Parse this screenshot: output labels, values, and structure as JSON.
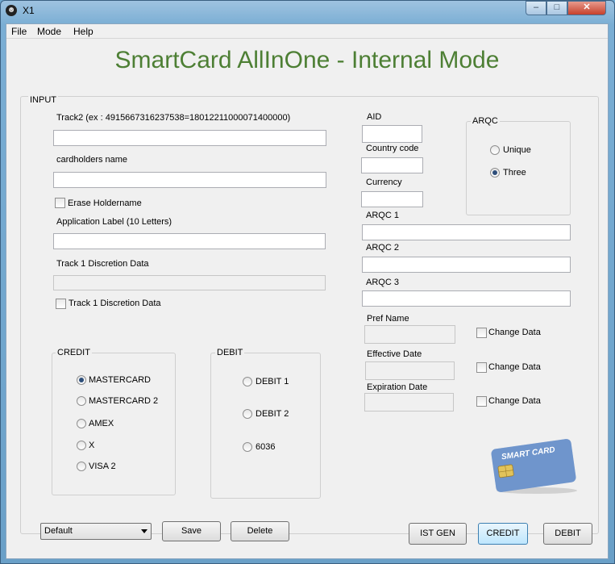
{
  "window": {
    "title": "X1",
    "controls": {
      "minimize": "–",
      "maximize": "□",
      "close": "✕"
    }
  },
  "menu": [
    "File",
    "Mode",
    "Help"
  ],
  "heading": "SmartCard AllInOne - Internal Mode",
  "input_group": {
    "label": "INPUT",
    "track2_label": "Track2 (ex : 4915667316237538=18012211000071400000)",
    "track2_value": "",
    "cardholder_label": "cardholders name",
    "cardholder_value": "",
    "erase_holdername": {
      "label": "Erase Holdername",
      "checked": false
    },
    "app_label_label": "Application Label (10 Letters)",
    "app_label_value": "",
    "track1_label": "Track 1 Discretion Data",
    "track1_value": "",
    "track1_checkbox": {
      "label": "Track 1 Discretion Data",
      "checked": false
    }
  },
  "credit": {
    "label": "CREDIT",
    "options": [
      {
        "label": "MASTERCARD",
        "checked": true
      },
      {
        "label": "MASTERCARD 2",
        "checked": false
      },
      {
        "label": "AMEX",
        "checked": false
      },
      {
        "label": "X",
        "checked": false
      },
      {
        "label": "VISA 2",
        "checked": false
      }
    ]
  },
  "debit": {
    "label": "DEBIT",
    "options": [
      {
        "label": "DEBIT 1",
        "checked": false
      },
      {
        "label": "DEBIT 2",
        "checked": false
      },
      {
        "label": "6036",
        "checked": false
      }
    ]
  },
  "emv": {
    "aid_label": "AID",
    "aid_value": "",
    "country_label": "Country code",
    "country_value": "",
    "currency_label": "Currency",
    "currency_value": "",
    "arqc1_label": "ARQC 1",
    "arqc1_value": "",
    "arqc2_label": "ARQC 2",
    "arqc2_value": "",
    "arqc3_label": "ARQC 3",
    "arqc3_value": ""
  },
  "arqc_group": {
    "label": "ARQC",
    "options": [
      {
        "label": "Unique",
        "checked": false
      },
      {
        "label": "Three",
        "checked": true
      }
    ]
  },
  "extra": {
    "pref_name_label": "Pref Name",
    "pref_name_value": "",
    "effective_label": "Effective Date",
    "effective_value": "",
    "expiration_label": "Expiration Date",
    "expiration_value": "",
    "change_data_label": "Change Data"
  },
  "card_image": {
    "text": "SMART CARD",
    "colors": {
      "card": "#5f88c4",
      "chip": "#e2c35a"
    }
  },
  "bottom": {
    "profile_select": "Default",
    "save": "Save",
    "delete": "Delete",
    "ist_gen": "IST GEN",
    "credit": "CREDIT",
    "debit": "DEBIT"
  }
}
